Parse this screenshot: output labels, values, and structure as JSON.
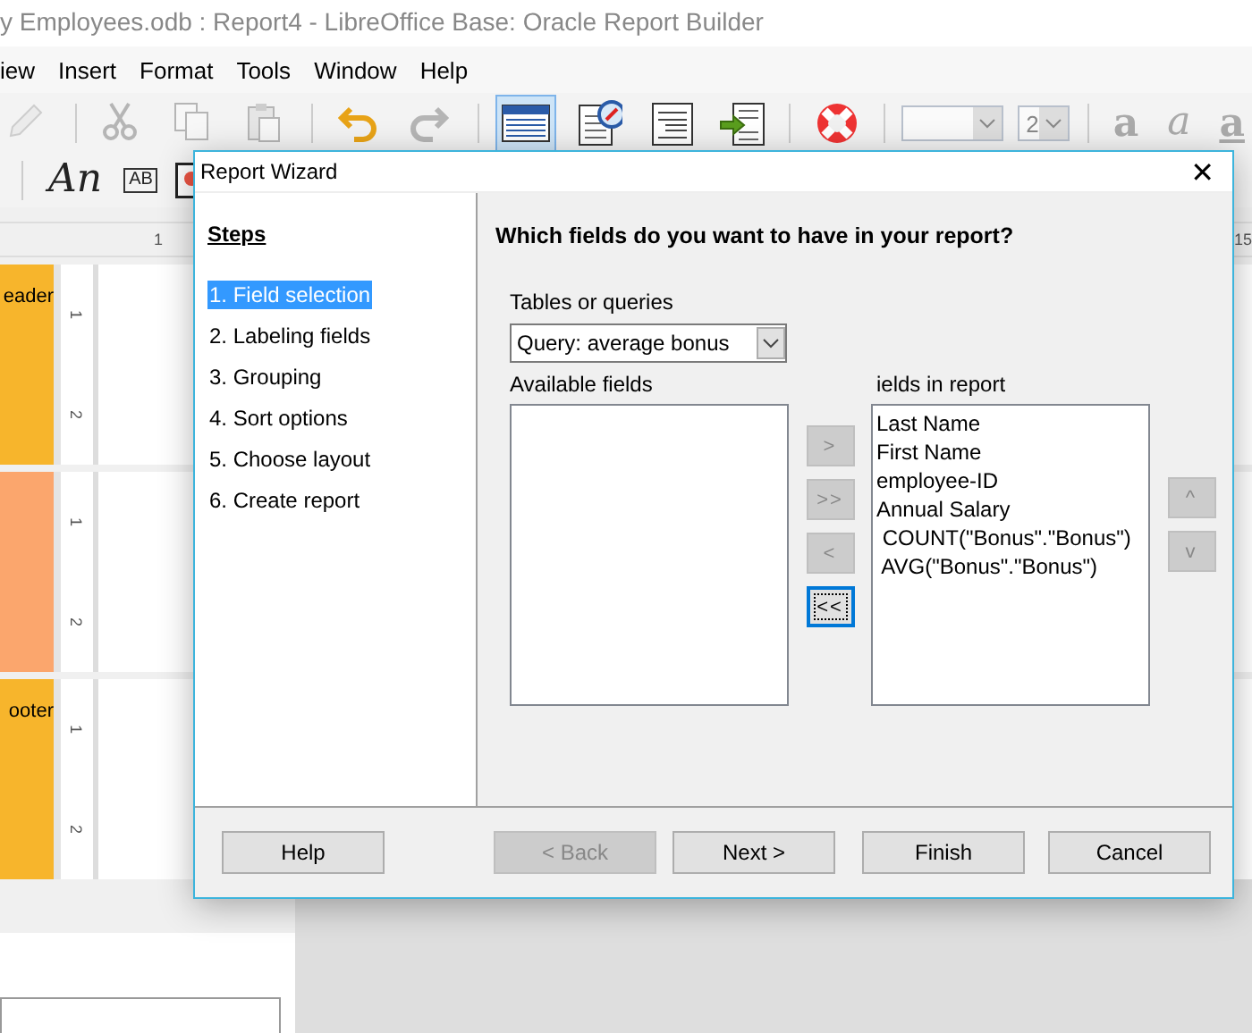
{
  "app": {
    "title": "y Employees.odb : Report4 - LibreOffice Base: Oracle Report Builder",
    "menu": [
      {
        "label": "iew"
      },
      {
        "label": "Insert"
      },
      {
        "label": "Format"
      },
      {
        "label": "Tools"
      },
      {
        "label": "Window"
      },
      {
        "label": "Help"
      }
    ],
    "toolbar": [
      {
        "kind": "edit",
        "disabled": true,
        "selected": false
      },
      {
        "kind": "separator"
      },
      {
        "kind": "cut",
        "disabled": true,
        "selected": false
      },
      {
        "kind": "copy",
        "disabled": true,
        "selected": false
      },
      {
        "kind": "paste",
        "disabled": true,
        "selected": false
      },
      {
        "kind": "separator"
      },
      {
        "kind": "undo",
        "disabled": false,
        "selected": false
      },
      {
        "kind": "redo",
        "disabled": true,
        "selected": false
      },
      {
        "kind": "separator"
      },
      {
        "kind": "table",
        "disabled": false,
        "selected": true
      },
      {
        "kind": "navigator",
        "disabled": false,
        "selected": false
      },
      {
        "kind": "page",
        "disabled": false,
        "selected": false
      },
      {
        "kind": "add-field",
        "disabled": false,
        "selected": false
      },
      {
        "kind": "separator"
      },
      {
        "kind": "help",
        "disabled": false,
        "selected": false
      },
      {
        "kind": "separator"
      },
      {
        "kind": "combo",
        "disabled": true
      },
      {
        "kind": "combo",
        "value": "2",
        "disabled": true
      },
      {
        "kind": "separator"
      },
      {
        "kind": "bold",
        "text": "a",
        "disabled": true
      },
      {
        "kind": "italic",
        "text": "a",
        "disabled": true
      },
      {
        "kind": "underline",
        "text": "a",
        "disabled": true
      }
    ],
    "toolbar2": [
      {
        "kind": "separator"
      },
      {
        "kind": "italic",
        "text": "An",
        "disabled": false
      },
      {
        "kind": "boxed",
        "text": "AB",
        "disabled": false
      },
      {
        "kind": "shapes",
        "disabled": false,
        "selected": false
      }
    ],
    "ruler": [
      "1",
      "15"
    ],
    "sections": [
      {
        "label": "eader",
        "color": "#f7b52c",
        "ruler": [
          "1",
          "2"
        ]
      },
      {
        "color": "#fba66d",
        "ruler": [
          "1",
          "2"
        ]
      },
      {
        "label": "ooter",
        "color": "#f7b52c",
        "ruler": [
          "1",
          "2"
        ]
      }
    ]
  },
  "dialog": {
    "title": "Report Wizard",
    "close": "✕",
    "steps_title": "Steps",
    "steps": [
      {
        "label": "1. Field selection",
        "selected": true
      },
      {
        "label": "2. Labeling fields",
        "selected": false
      },
      {
        "label": "3. Grouping",
        "selected": false
      },
      {
        "label": "4. Sort options",
        "selected": false
      },
      {
        "label": "5. Choose layout",
        "selected": false
      },
      {
        "label": "6. Create report",
        "selected": false
      }
    ],
    "heading": "Which fields do you want to have in your report?",
    "source": {
      "label": "Tables or queries",
      "value": "Query: average bonus"
    },
    "available": {
      "label": "Available fields"
    },
    "report_fields": {
      "label": "ields in report",
      "items": [
        "Last Name",
        "First Name",
        "employee-ID",
        "Annual Salary",
        " COUNT(\"Bonus\".\"Bonus\")",
        " AVG(\"Bonus\".\"Bonus\")"
      ]
    },
    "move_buttons": [
      {
        "label": ">",
        "disabled": true,
        "focused": false
      },
      {
        "label": ">>",
        "disabled": true,
        "focused": false
      },
      {
        "label": "<",
        "disabled": true,
        "focused": false
      },
      {
        "label": "<<",
        "disabled": false,
        "focused": true
      }
    ],
    "order_buttons": [
      {
        "label": "^",
        "disabled": true
      },
      {
        "label": "v",
        "disabled": true
      }
    ],
    "buttons": [
      {
        "label": "Help",
        "disabled": false
      },
      {
        "label": "< Back",
        "disabled": true
      },
      {
        "label": "Next >",
        "disabled": false
      },
      {
        "label": "Finish",
        "disabled": false
      },
      {
        "label": "Cancel",
        "disabled": false
      }
    ]
  }
}
